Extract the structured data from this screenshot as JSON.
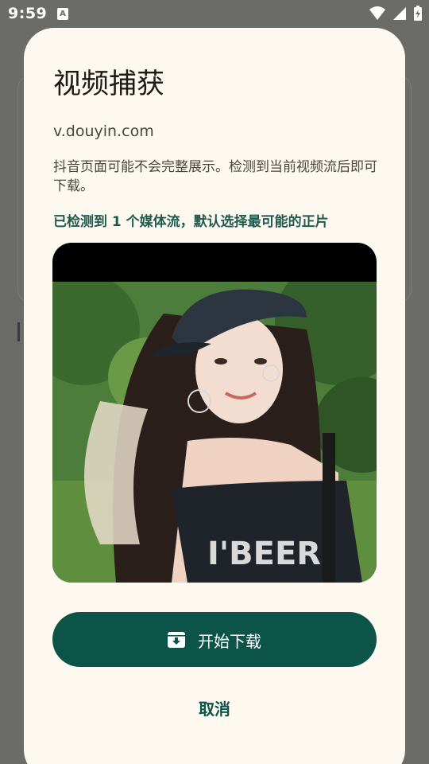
{
  "status_bar": {
    "time": "9:59",
    "notification_glyph": "A",
    "icons": [
      "wifi-icon",
      "signal-icon",
      "battery-charging-icon"
    ]
  },
  "dialog": {
    "title": "视频捕获",
    "url": "v.douyin.com",
    "description": "抖音页面可能不会完整展示。检测到当前视频流后即可下载。",
    "status": "已检测到 1 个媒体流，默认选择最可能的正片",
    "download_button": {
      "label": "开始下载",
      "icon": "download-box-icon"
    },
    "cancel_label": "取消"
  },
  "colors": {
    "scrim": "#6b6b68",
    "dialog_background": "#fdf8f0",
    "primary": "#0b5447",
    "status_text": "#1f5a4e"
  }
}
